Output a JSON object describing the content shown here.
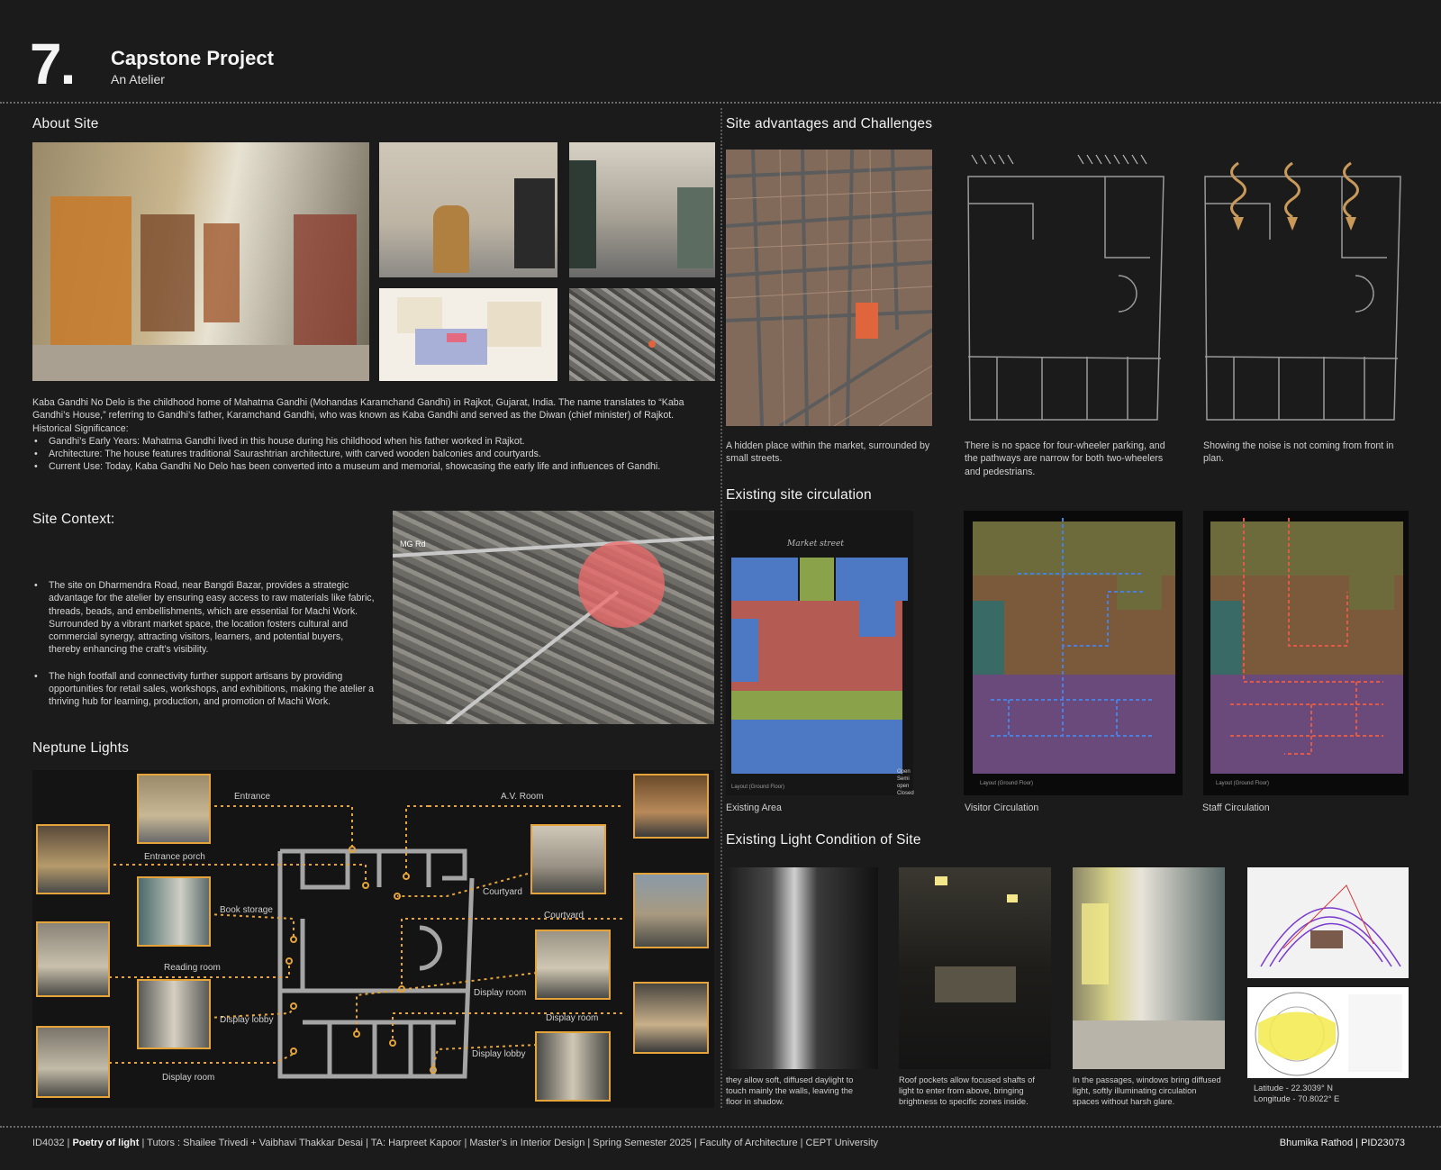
{
  "header": {
    "number": "7.",
    "title": "Capstone Project",
    "subtitle": "An Atelier"
  },
  "about_site": {
    "heading": "About Site",
    "para1": "Kaba Gandhi No Delo is the childhood home of Mahatma Gandhi (Mohandas Karamchand Gandhi) in Rajkot, Gujarat, India. The name translates to “Kaba Gandhi’s House,” referring to Gandhi’s father, Karamchand Gandhi, who was known as Kaba Gandhi and served as the Diwan (chief minister) of Rajkot.",
    "hist_label": "Historical Significance:",
    "bullets": [
      "Gandhi’s Early Years: Mahatma Gandhi lived in this house during his childhood when his father worked in Rajkot.",
      "Architecture: The house features traditional Saurashtrian architecture, with carved wooden balconies and courtyards.",
      "Current Use: Today, Kaba Gandhi No Delo has been converted into a museum and memorial, showcasing the early life and influences of Gandhi."
    ]
  },
  "site_context": {
    "heading": "Site Context:",
    "bullets": [
      "The site on Dharmendra Road, near Bangdi Bazar, provides a strategic advantage for the atelier by ensuring easy access to raw materials like fabric, threads, beads, and embellishments, which are essential for Machi Work. Surrounded by a vibrant market space, the location fosters cultural and commercial synergy, attracting visitors, learners, and potential buyers, thereby enhancing the craft’s visibility.",
      "The high footfall and connectivity further support artisans by providing opportunities for retail sales, workshops, and exhibitions, making the atelier a thriving hub for learning, production, and promotion of Machi Work."
    ],
    "map_label": "MG Rd"
  },
  "neptune": {
    "heading": "Neptune Lights",
    "labels": {
      "entrance": "Entrance",
      "av_room": "A.V. Room",
      "entrance_porch": "Entrance porch",
      "courtyard1": "Courtyard",
      "courtyard2": "Courtyard",
      "book_storage": "Book storage",
      "reading_room": "Reading room",
      "display_room1": "Display room",
      "display_room2": "Display room",
      "display_room3": "Display room",
      "display_lobby1": "Display lobby",
      "display_lobby2": "Display lobby"
    }
  },
  "advantages": {
    "heading": "Site advantages and Challenges",
    "cap1": "A hidden place within the market, surrounded by small streets.",
    "cap2": "There is no space for four-wheeler parking, and the pathways are narrow for both two-wheelers and pedestrians.",
    "cap3": "Showing the noise is not coming from front in plan."
  },
  "circulation": {
    "heading": "Existing site circulation",
    "cap1": "Existing Area",
    "cap2": "Visitor Circulation",
    "cap3": "Staff Circulation",
    "market_street": "Market street",
    "legend": [
      "Open",
      "Semi open",
      "Closed"
    ],
    "plan_label": "Layout (Ground Floor)"
  },
  "light": {
    "heading": "Existing Light Condition of Site",
    "cap1": "they allow soft, diffused daylight to touch mainly the walls, leaving the floor in shadow.",
    "cap2": "Roof pockets allow focused shafts of light to enter from above, bringing brightness to specific zones inside.",
    "cap3": "In the passages, windows bring diffused light, softly illuminating circulation spaces without harsh glare.",
    "latitude": "Latitude - 22.3039° N",
    "longitude": "Longitude - 70.8022° E"
  },
  "footer": {
    "code": "ID4032 | ",
    "course": "Poetry of light",
    "rest": " | Tutors : Shailee Trivedi + Vaibhavi Thakkar Desai | TA: Harpreet Kapoor | Master’s in Interior Design | Spring Semester 2025 | Faculty of Architecture | CEPT University",
    "author": "Bhumika Rathod | PID23073"
  },
  "colors": {
    "background": "#1b1b1b",
    "accent": "#e4a43a",
    "highlight": "#e0643c"
  }
}
